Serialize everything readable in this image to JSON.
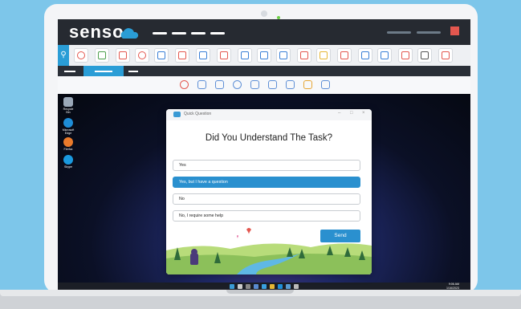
{
  "app": {
    "logo_text": "senso"
  },
  "dialog": {
    "window_title": "Quick Question",
    "question": "Did You Understand The Task?",
    "options": [
      {
        "label": "Yes",
        "selected": false
      },
      {
        "label": "Yes, but I have a question",
        "selected": true
      },
      {
        "label": "No",
        "selected": false
      },
      {
        "label": "No,  I require some help",
        "selected": false
      }
    ],
    "send_label": "Send"
  },
  "desktop": {
    "icons": [
      {
        "label": "Recycle Bin",
        "icon": "recycle-bin-icon"
      },
      {
        "label": "Microsoft Edge",
        "icon": "edge-icon"
      },
      {
        "label": "Firefox",
        "icon": "firefox-icon"
      },
      {
        "label": "Skype",
        "icon": "skype-icon"
      }
    ]
  },
  "taskbar": {
    "time": "9:06 AM",
    "date": "1/16/2023"
  },
  "colors": {
    "accent": "#2a90cf",
    "header_bg": "#262a31",
    "alert": "#e3574f",
    "sky": "#7dc6ea"
  }
}
